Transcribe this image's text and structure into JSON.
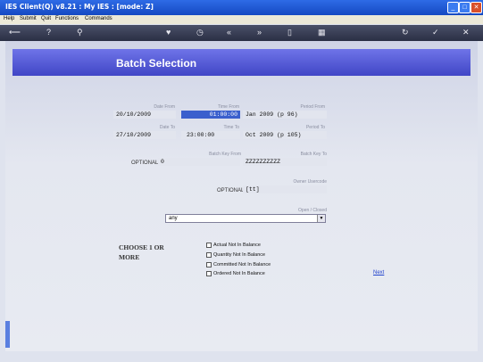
{
  "window": {
    "title": "IES Client(Q) v8.21 : My IES :      [mode: Z]"
  },
  "menu": [
    "Help",
    "Submit",
    "Quit",
    "Functions",
    "Commands"
  ],
  "toolbar_icons": [
    "back-icon",
    "help-icon",
    "search-icon",
    "heart-icon",
    "clock-icon",
    "rewind-icon",
    "fast-forward-icon",
    "document-icon",
    "grid-icon",
    "refresh-icon",
    "check-icon",
    "close-icon"
  ],
  "page": {
    "title": "Batch Selection"
  },
  "form": {
    "date_from_label": "Date From",
    "date_from": "20/10/2009",
    "time_from_label": "Time From",
    "time_from": "01:00:00",
    "period_from_label": "Period From",
    "period_from": "Jan 2009 (p 96)",
    "date_to_label": "Date To",
    "date_to": "27/10/2009",
    "time_to_label": "Time To",
    "time_to": "23:00:00",
    "period_to_label": "Period To",
    "period_to": "Oct 2009 (p 105)",
    "optional1": "OPTIONAL",
    "batch_key_from_label": "Batch Key From",
    "batch_key_from": "0",
    "batch_key_to_label": "Batch Key To",
    "batch_key_to": "ZZZZZZZZZZ",
    "owner_label": "Owner Usercode",
    "optional2": "OPTIONAL",
    "owner": "[tt]",
    "open_closed_label": "Open / Closed",
    "open_closed": "any"
  },
  "choose": {
    "line1": "CHOOSE 1 OR",
    "line2": "MORE"
  },
  "checks": [
    "Actual Not In Balance",
    "Quantity Not In Balance",
    "Committed Not In Balance",
    "Ordered Not In Balance"
  ],
  "next": "Next"
}
